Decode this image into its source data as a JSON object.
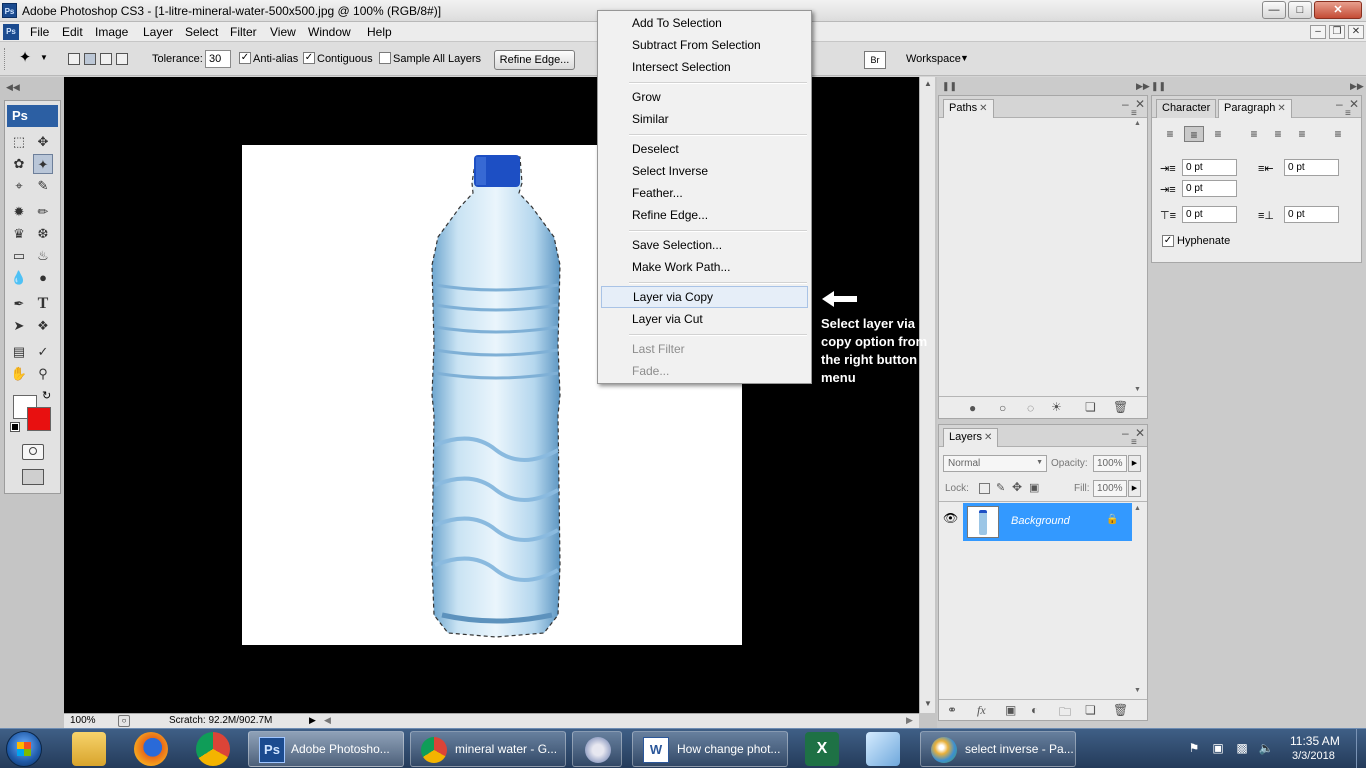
{
  "window": {
    "title": "Adobe Photoshop CS3 - [1-litre-mineral-water-500x500.jpg @ 100% (RGB/8#)]",
    "app_icon": "Ps"
  },
  "menubar": {
    "items": [
      "File",
      "Edit",
      "Image",
      "Layer",
      "Select",
      "Filter",
      "View",
      "Window",
      "Help"
    ]
  },
  "options_bar": {
    "tolerance_label": "Tolerance:",
    "tolerance_value": "30",
    "anti_alias_label": "Anti-alias",
    "anti_alias_checked": true,
    "contiguous_label": "Contiguous",
    "contiguous_checked": true,
    "sample_all_label": "Sample All Layers",
    "sample_all_checked": false,
    "refine_edge_label": "Refine Edge...",
    "workspace_label": "Workspace"
  },
  "toolbox": {
    "logo": "Ps",
    "foreground_color": "#ffffff",
    "background_color": "#e81010"
  },
  "context_menu": {
    "items": [
      {
        "label": "Add To Selection",
        "enabled": true
      },
      {
        "label": "Subtract From Selection",
        "enabled": true
      },
      {
        "label": "Intersect Selection",
        "enabled": true
      },
      {
        "label": "Grow",
        "enabled": true
      },
      {
        "label": "Similar",
        "enabled": true
      },
      {
        "label": "Deselect",
        "enabled": true
      },
      {
        "label": "Select Inverse",
        "enabled": true
      },
      {
        "label": "Feather...",
        "enabled": true
      },
      {
        "label": "Refine Edge...",
        "enabled": true
      },
      {
        "label": "Save Selection...",
        "enabled": true
      },
      {
        "label": "Make Work Path...",
        "enabled": true
      },
      {
        "label": "Layer via Copy",
        "enabled": true,
        "highlighted": true
      },
      {
        "label": "Layer via Cut",
        "enabled": true
      },
      {
        "label": "Last Filter",
        "enabled": false
      },
      {
        "label": "Fade...",
        "enabled": false
      }
    ]
  },
  "annotation": {
    "text": "Select layer via copy option from the right button menu"
  },
  "status_bar": {
    "zoom": "100%",
    "scratch": "Scratch: 92.2M/902.7M"
  },
  "paths_panel": {
    "tab": "Paths"
  },
  "paragraph_panel": {
    "tabs": [
      "Character",
      "Paragraph"
    ],
    "active_tab": "Paragraph",
    "indent_left": "0 pt",
    "indent_right": "0 pt",
    "indent_first": "0 pt",
    "space_before": "0 pt",
    "space_after": "0 pt",
    "hyphenate_label": "Hyphenate",
    "hyphenate_checked": true
  },
  "layers_panel": {
    "tab": "Layers",
    "blend_mode": "Normal",
    "opacity_label": "Opacity:",
    "opacity_value": "100%",
    "lock_label": "Lock:",
    "fill_label": "Fill:",
    "fill_value": "100%",
    "layers": [
      {
        "name": "Background",
        "visible": true,
        "locked": true,
        "selected": true
      }
    ],
    "accent_color": "#3399ff"
  },
  "taskbar": {
    "buttons": [
      {
        "label": "Adobe Photosho...",
        "icon": "photoshop-icon",
        "active": true
      },
      {
        "label": "mineral water - G...",
        "icon": "chrome-icon",
        "active": false
      },
      {
        "label": "How change phot...",
        "icon": "word-icon",
        "active": false
      },
      {
        "label": "select inverse - Pa...",
        "icon": "paint-icon",
        "active": false
      }
    ],
    "clock_time": "11:35 AM",
    "clock_date": "3/3/2018"
  }
}
